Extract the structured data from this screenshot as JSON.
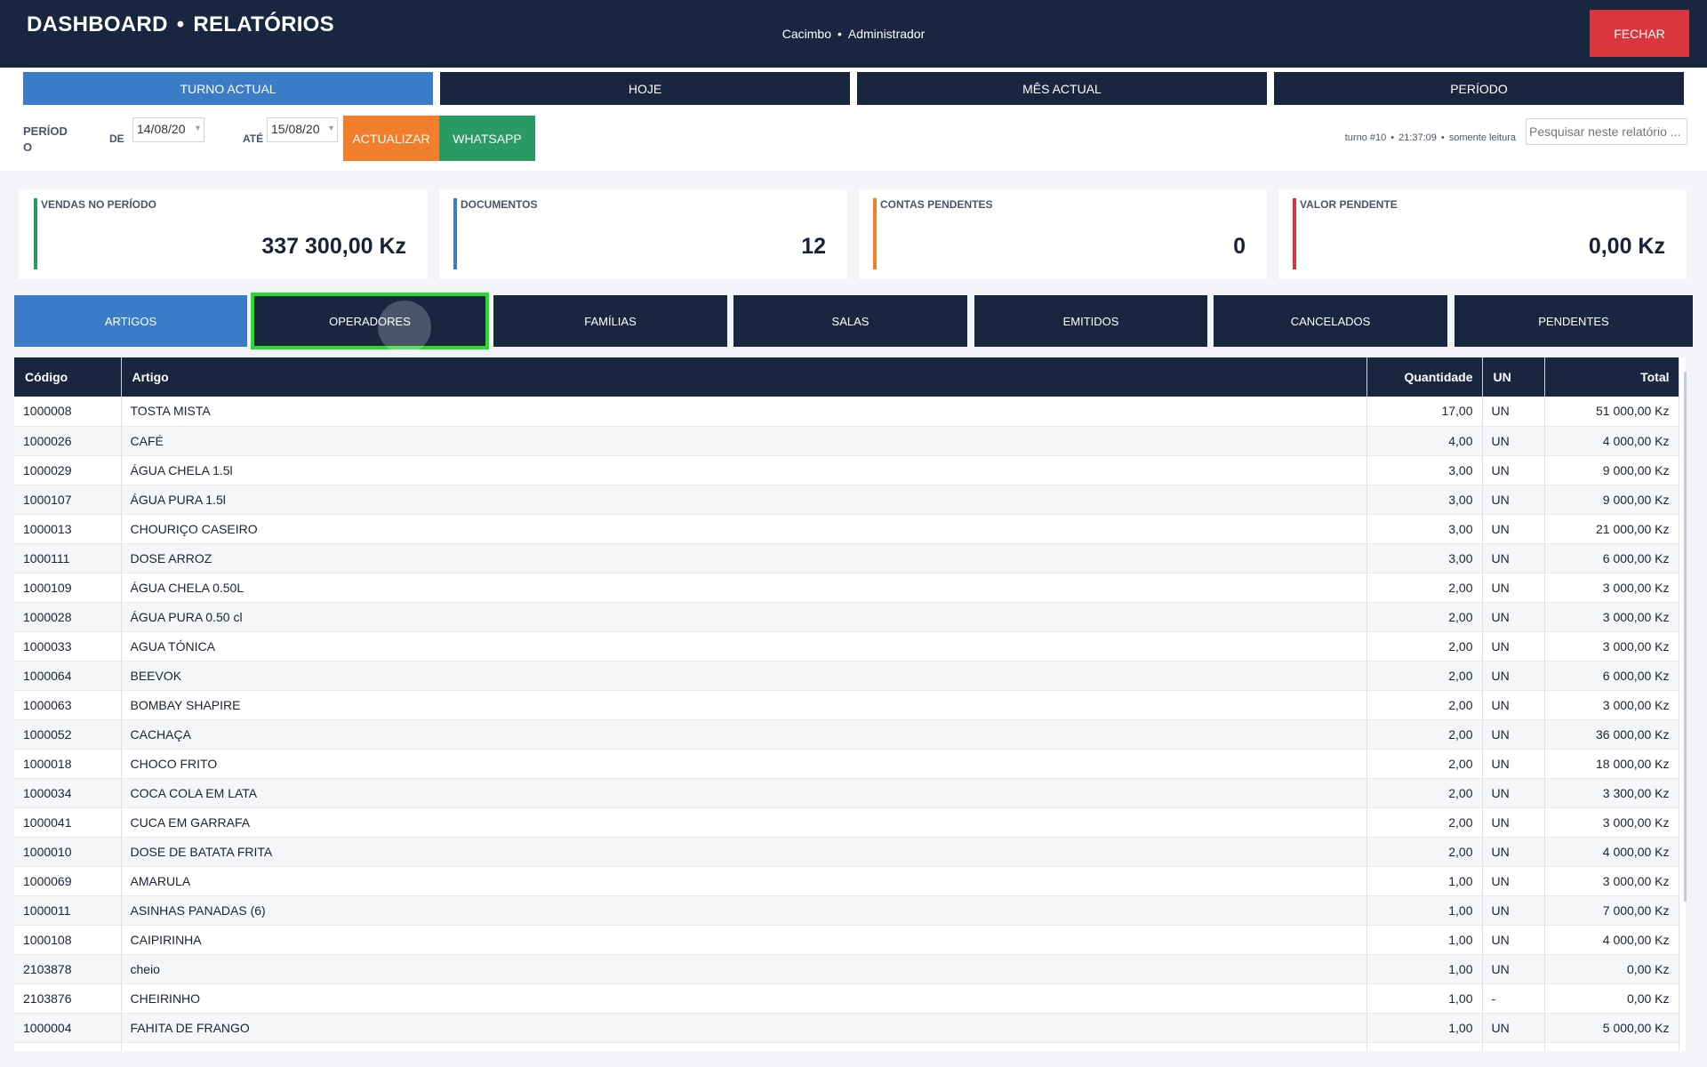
{
  "header": {
    "title_left": "DASHBOARD",
    "title_right": "RELATÓRIOS",
    "company": "Cacimbo",
    "role": "Administrador",
    "close_label": "FECHAR"
  },
  "period_tabs": [
    {
      "label": "TURNO ACTUAL",
      "active": true
    },
    {
      "label": "HOJE",
      "active": false
    },
    {
      "label": "MÊS ACTUAL",
      "active": false
    },
    {
      "label": "PERÍODO",
      "active": false
    }
  ],
  "filters": {
    "period_label_1": "PERÍOD",
    "period_label_2": "O",
    "from_label": "DE",
    "from_value": "14/08/20",
    "to_label": "ATÉ",
    "to_value": "15/08/20",
    "update_label": "ACTUALIZAR",
    "whatsapp_label": "WHATSAPP",
    "turno": "turno #10",
    "time": "21:37:09",
    "mode": "somente leitura",
    "search_placeholder": "Pesquisar neste relatório ..."
  },
  "cards": [
    {
      "label": "VENDAS NO PERÍODO",
      "value": "337 300,00 Kz",
      "color": "#2a9a63"
    },
    {
      "label": "DOCUMENTOS",
      "value": "12",
      "color": "#3b7cc8"
    },
    {
      "label": "CONTAS PENDENTES",
      "value": "0",
      "color": "#f07e2a"
    },
    {
      "label": "VALOR PENDENTE",
      "value": "0,00 Kz",
      "color": "#d9363e"
    }
  ],
  "category_tabs": [
    {
      "label": "ARTIGOS",
      "active": true
    },
    {
      "label": "OPERADORES",
      "active": false,
      "focused": true
    },
    {
      "label": "FAMÍLIAS",
      "active": false
    },
    {
      "label": "SALAS",
      "active": false
    },
    {
      "label": "EMITIDOS",
      "active": false
    },
    {
      "label": "CANCELADOS",
      "active": false
    },
    {
      "label": "PENDENTES",
      "active": false
    }
  ],
  "table": {
    "headers": [
      "Código",
      "Artigo",
      "Quantidade",
      "UN",
      "Total"
    ],
    "rows": [
      [
        "1000008",
        "TOSTA MISTA",
        "17,00",
        "UN",
        "51 000,00 Kz"
      ],
      [
        "1000026",
        "CAFÉ",
        "4,00",
        "UN",
        "4 000,00 Kz"
      ],
      [
        "1000029",
        "ÁGUA CHELA 1.5l",
        "3,00",
        "UN",
        "9 000,00 Kz"
      ],
      [
        "1000107",
        "ÁGUA PURA 1.5l",
        "3,00",
        "UN",
        "9 000,00 Kz"
      ],
      [
        "1000013",
        "CHOURIÇO CASEIRO",
        "3,00",
        "UN",
        "21 000,00 Kz"
      ],
      [
        "1000111",
        "DOSE ARROZ",
        "3,00",
        "UN",
        "6 000,00 Kz"
      ],
      [
        "1000109",
        "ÁGUA CHELA 0.50L",
        "2,00",
        "UN",
        "3 000,00 Kz"
      ],
      [
        "1000028",
        "ÁGUA PURA 0.50 cl",
        "2,00",
        "UN",
        "3 000,00 Kz"
      ],
      [
        "1000033",
        "AGUA TÓNICA",
        "2,00",
        "UN",
        "3 000,00 Kz"
      ],
      [
        "1000064",
        "BEEVOK",
        "2,00",
        "UN",
        "6 000,00 Kz"
      ],
      [
        "1000063",
        "BOMBAY SHAPIRE",
        "2,00",
        "UN",
        "3 000,00 Kz"
      ],
      [
        "1000052",
        "CACHAÇA",
        "2,00",
        "UN",
        "36 000,00 Kz"
      ],
      [
        "1000018",
        "CHOCO FRITO",
        "2,00",
        "UN",
        "18 000,00 Kz"
      ],
      [
        "1000034",
        "COCA COLA EM LATA",
        "2,00",
        "UN",
        "3 300,00 Kz"
      ],
      [
        "1000041",
        "CUCA EM GARRAFA",
        "2,00",
        "UN",
        "3 000,00 Kz"
      ],
      [
        "1000010",
        "DOSE DE BATATA FRITA",
        "2,00",
        "UN",
        "4 000,00 Kz"
      ],
      [
        "1000069",
        "AMARULA",
        "1,00",
        "UN",
        "3 000,00 Kz"
      ],
      [
        "1000011",
        "ASINHAS PANADAS (6)",
        "1,00",
        "UN",
        "7 000,00 Kz"
      ],
      [
        "1000108",
        "CAIPIRINHA",
        "1,00",
        "UN",
        "4 000,00 Kz"
      ],
      [
        "2103878",
        "cheio",
        "1,00",
        "UN",
        "0,00 Kz"
      ],
      [
        "2103876",
        "CHEIRINHO",
        "1,00",
        "-",
        "0,00 Kz"
      ],
      [
        "1000004",
        "FAHITA DE FRANGO",
        "1,00",
        "UN",
        "5 000,00 Kz"
      ],
      [
        "",
        "",
        "",
        "",
        ""
      ]
    ]
  }
}
